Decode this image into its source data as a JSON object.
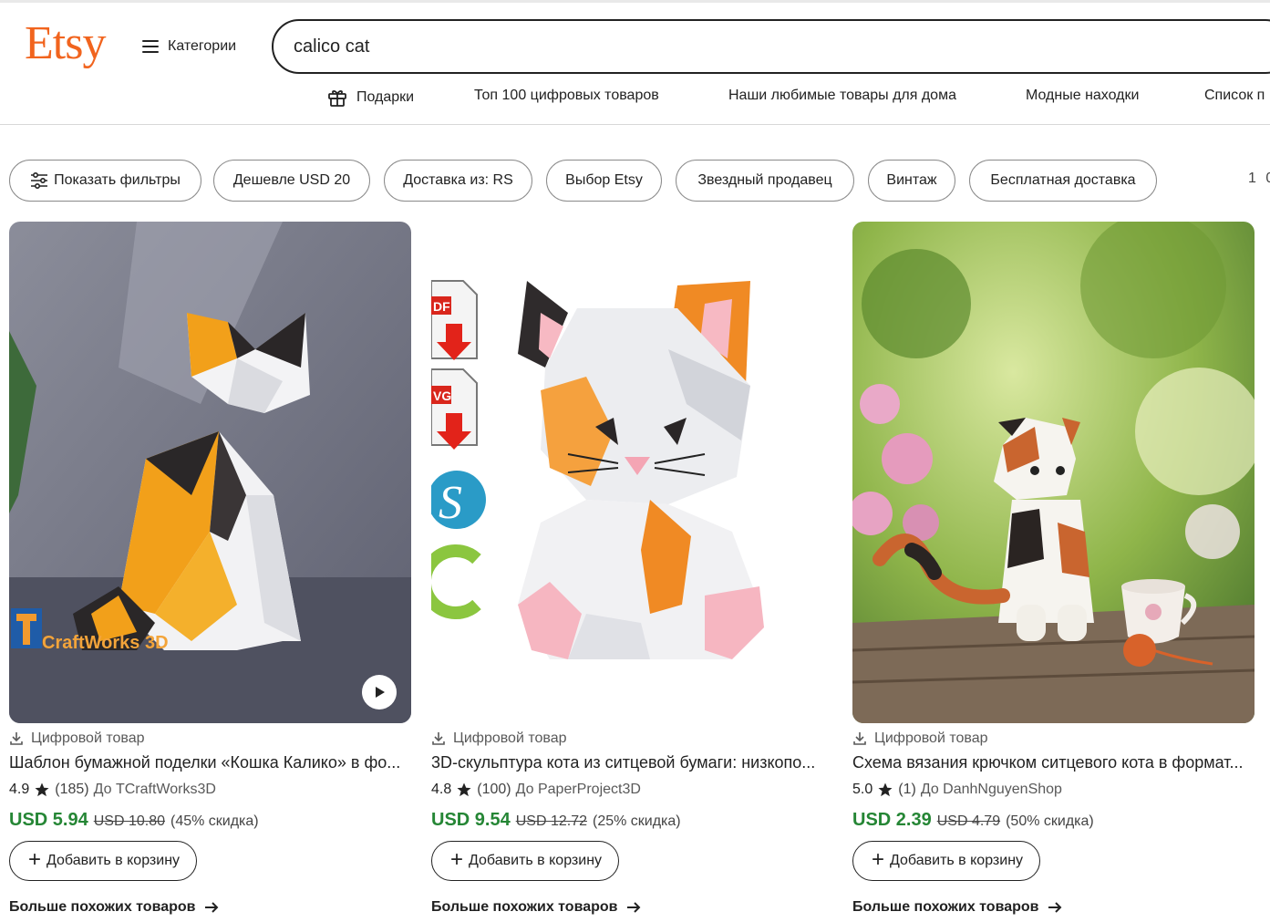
{
  "header": {
    "logo": "Etsy",
    "categories_label": "Категории",
    "search_value": "calico cat"
  },
  "nav": {
    "items": [
      {
        "label": "Подарки",
        "icon": "gift-icon"
      },
      {
        "label": "Топ 100 цифровых товаров"
      },
      {
        "label": "Наши любимые товары для дома"
      },
      {
        "label": "Модные находки"
      },
      {
        "label": "Список п"
      }
    ]
  },
  "filters": {
    "show_filters": "Показать фильтры",
    "chips": [
      "Дешевле USD 20",
      "Доставка из: RS",
      "Выбор Etsy",
      "Звездный продавец",
      "Винтаж",
      "Бесплатная доставка"
    ],
    "results_count": "1 0"
  },
  "listings": [
    {
      "type": "Цифровой товар",
      "title": "Шаблон бумажной поделки «Кошка Калико» в фо...",
      "rating": "4.9",
      "reviews": "(185)",
      "shop": "До TCraftWorks3D",
      "price": "USD 5.94",
      "old_price": "USD 10.80",
      "discount": "(45% скидка)",
      "watermark": "CraftWorks 3D",
      "add_to_cart": "Добавить в корзину",
      "more_like": "Больше похожих товаров"
    },
    {
      "type": "Цифровой товар",
      "title": "3D-скульптура кота из ситцевой бумаги: низкопо...",
      "rating": "4.8",
      "reviews": "(100)",
      "shop": "До PaperProject3D",
      "price": "USD 9.54",
      "old_price": "USD 12.72",
      "discount": "(25% скидка)",
      "file_labels": [
        "DF",
        "VG"
      ],
      "add_to_cart": "Добавить в корзину",
      "more_like": "Больше похожих товаров"
    },
    {
      "type": "Цифровой товар",
      "title": "Схема вязания крючком ситцевого кота в формат...",
      "rating": "5.0",
      "reviews": "(1)",
      "shop": "До DanhNguyenShop",
      "price": "USD 2.39",
      "old_price": "USD 4.79",
      "discount": "(50% скидка)",
      "add_to_cart": "Добавить в корзину",
      "more_like": "Больше похожих товаров"
    }
  ],
  "colors": {
    "brand": "#F1641E",
    "price_green": "#258635"
  }
}
